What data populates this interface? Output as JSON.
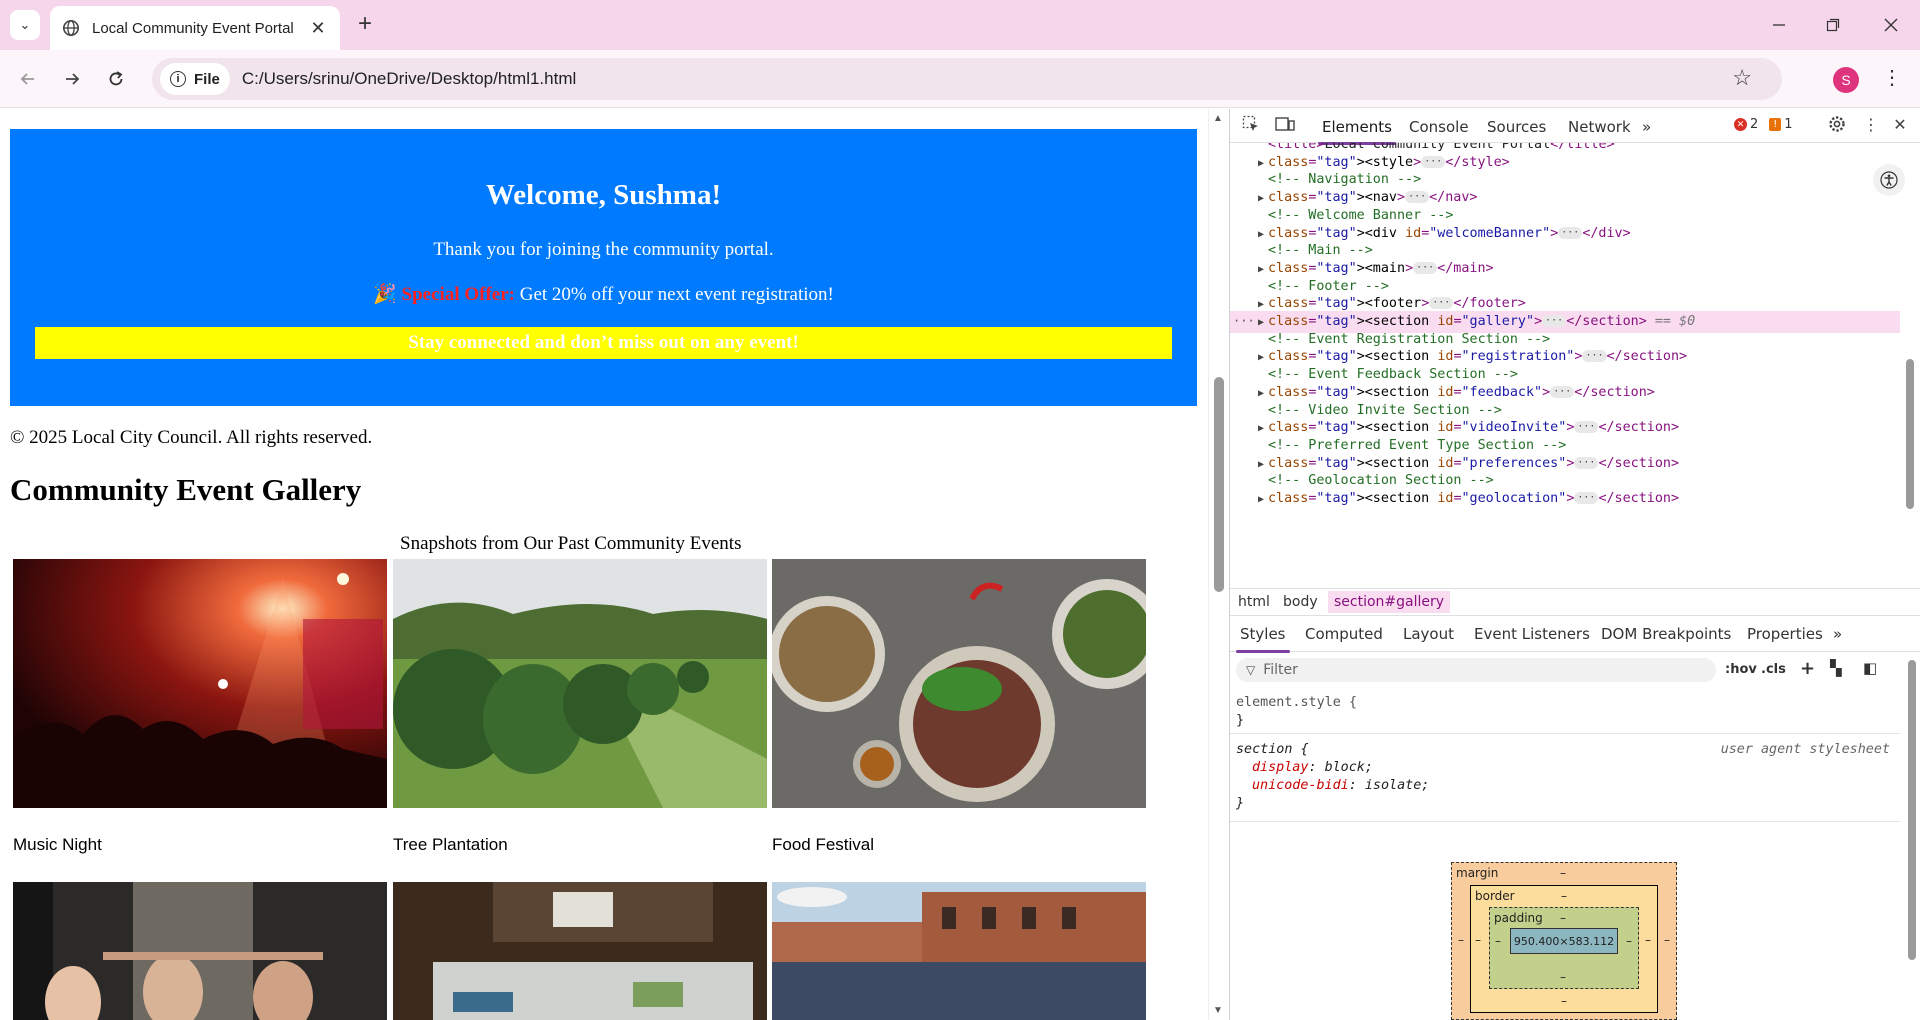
{
  "browser": {
    "tab_title": "Local Community Event Portal",
    "new_tab_symbol": "+",
    "close_symbol": "✕",
    "url_chip": "File",
    "url": "C:/Users/srinu/OneDrive/Desktop/html1.html",
    "profile_initial": "S",
    "icons": [
      "tab-search-icon",
      "globe-icon",
      "back-icon",
      "forward-icon",
      "reload-icon",
      "info-icon",
      "star-icon",
      "kebab-icon",
      "minimize-icon",
      "maximize-icon",
      "close-icon"
    ]
  },
  "page": {
    "banner": {
      "heading": "Welcome, Sushma!",
      "thanks": "Thank you for joining the community portal.",
      "offer_emoji": "🎉",
      "offer_label": "Special Offer:",
      "offer_text": "Get 20% off your next event registration!",
      "stay": "Stay connected and don’t miss out on any event!",
      "bg_color": "#007bff"
    },
    "copyright": "© 2025 Local City Council. All rights reserved.",
    "gallery": {
      "title": "Community Event Gallery",
      "caption": "Snapshots from Our Past Community Events",
      "items": [
        {
          "label": "Music Night"
        },
        {
          "label": "Tree Plantation"
        },
        {
          "label": "Food Festival"
        },
        {
          "label": ""
        },
        {
          "label": ""
        },
        {
          "label": ""
        }
      ]
    }
  },
  "devtools": {
    "tabs": [
      "Elements",
      "Console",
      "Sources",
      "Network"
    ],
    "more": "»",
    "errors": "2",
    "warnings": "1",
    "dom_lines": [
      {
        "kind": "tag",
        "text": "<title>Local Community Event Portal</title>"
      },
      {
        "kind": "collapsed",
        "text": "<style>",
        "close": "</style>"
      },
      {
        "kind": "comment",
        "text": "<!-- Navigation -->"
      },
      {
        "kind": "collapsed",
        "text": "<nav>",
        "close": "</nav>"
      },
      {
        "kind": "comment",
        "text": "<!-- Welcome Banner -->"
      },
      {
        "kind": "collapsed",
        "text": "<div id=\"welcomeBanner\">",
        "close": "</div>"
      },
      {
        "kind": "comment",
        "text": "<!-- Main -->"
      },
      {
        "kind": "collapsed",
        "text": "<main>",
        "close": "</main>"
      },
      {
        "kind": "comment",
        "text": "<!-- Footer -->"
      },
      {
        "kind": "collapsed",
        "text": "<footer>",
        "close": "</footer>"
      },
      {
        "kind": "selected",
        "text": "<section id=\"gallery\">",
        "close": "</section>",
        "suffix": "== $0"
      },
      {
        "kind": "comment",
        "text": "<!-- Event Registration Section -->"
      },
      {
        "kind": "collapsed",
        "text": "<section id=\"registration\">",
        "close": "</section>"
      },
      {
        "kind": "comment",
        "text": "<!-- Event Feedback Section -->"
      },
      {
        "kind": "collapsed",
        "text": "<section id=\"feedback\">",
        "close": "</section>"
      },
      {
        "kind": "comment",
        "text": "<!-- Video Invite Section -->"
      },
      {
        "kind": "collapsed",
        "text": "<section id=\"videoInvite\">",
        "close": "</section>"
      },
      {
        "kind": "comment",
        "text": "<!-- Preferred Event Type Section -->"
      },
      {
        "kind": "collapsed",
        "text": "<section id=\"preferences\">",
        "close": "</section>"
      },
      {
        "kind": "comment",
        "text": "<!-- Geolocation Section -->"
      },
      {
        "kind": "collapsed",
        "text": "<section id=\"geolocation\">",
        "close": "</section>"
      }
    ],
    "breadcrumbs": [
      "html",
      "body",
      "section#gallery"
    ],
    "style_tabs": [
      "Styles",
      "Computed",
      "Layout",
      "Event Listeners",
      "DOM Breakpoints",
      "Properties"
    ],
    "filter_placeholder": "Filter",
    "hov": ":hov",
    "cls": ".cls",
    "styles": {
      "element_style": "element.style {",
      "close": "}",
      "section_selector": "section {",
      "uas": "user agent stylesheet",
      "props": [
        {
          "name": "display",
          "value": "block;"
        },
        {
          "name": "unicode-bidi",
          "value": "isolate;"
        }
      ]
    },
    "box_model": {
      "margin": "margin",
      "border": "border",
      "padding": "padding",
      "dash": "–",
      "content": "950.400×583.112"
    }
  }
}
